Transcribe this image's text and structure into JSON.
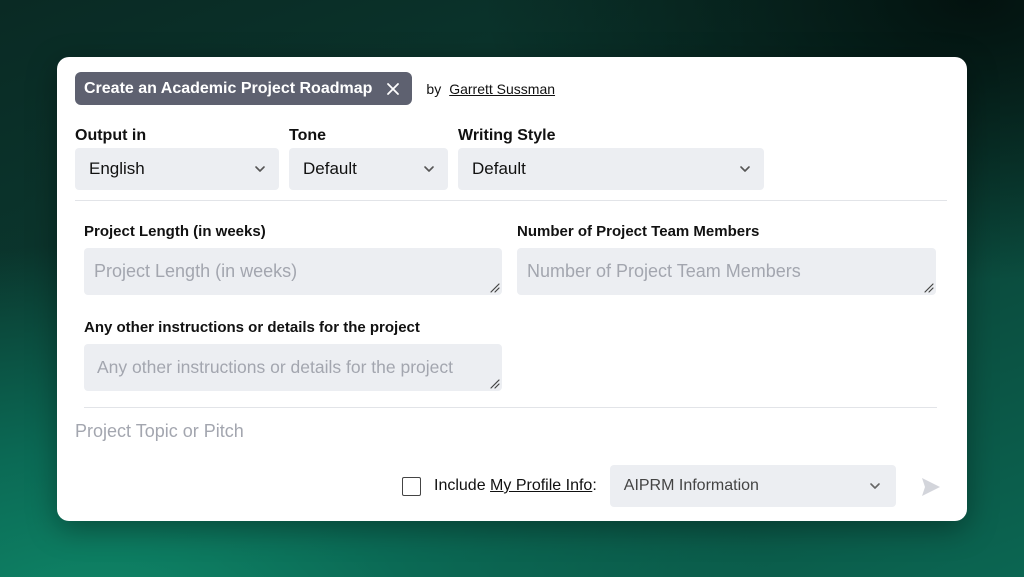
{
  "header": {
    "title": "Create an Academic Project Roadmap",
    "by_label": "by",
    "author": "Garrett Sussman"
  },
  "options": {
    "output": {
      "label": "Output in",
      "value": "English"
    },
    "tone": {
      "label": "Tone",
      "value": "Default"
    },
    "style": {
      "label": "Writing Style",
      "value": "Default"
    }
  },
  "fields": {
    "length": {
      "label": "Project Length (in weeks)",
      "placeholder": "Project Length (in weeks)"
    },
    "members": {
      "label": "Number of Project Team Members",
      "placeholder": "Number of Project Team Members"
    },
    "other": {
      "label": "Any other instructions or details for the project",
      "placeholder": "Any other instructions or details for the project"
    }
  },
  "prompt": {
    "placeholder": "Project Topic or Pitch"
  },
  "footer": {
    "include_prefix": "Include",
    "profile_link": "My Profile Info",
    "colon": ":",
    "aiprm_select": "AIPRM Information"
  },
  "icons": {
    "close": "close-icon",
    "chevron": "chevron-down-icon",
    "send": "send-icon",
    "resize": "resize-grip-icon"
  },
  "colors": {
    "title_chip_bg": "#5e6170",
    "input_bg": "#eceef2",
    "placeholder": "#a3a6af"
  }
}
